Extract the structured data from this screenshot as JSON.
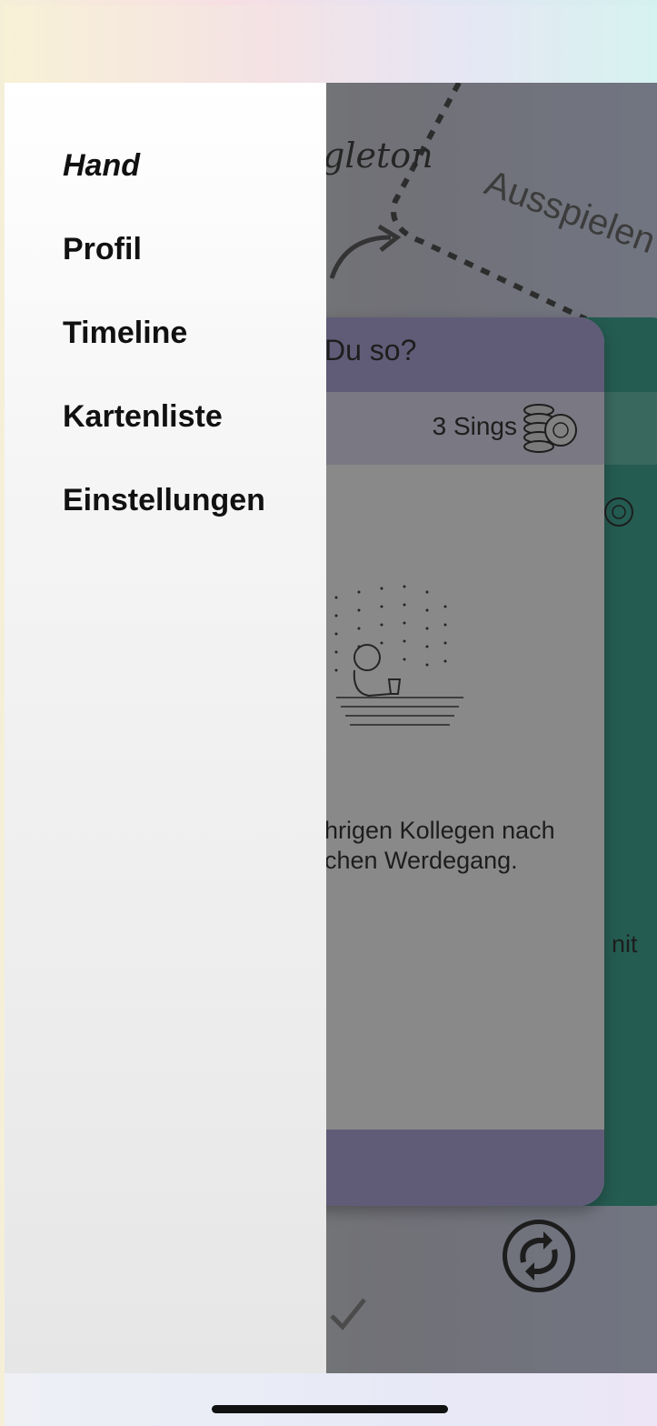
{
  "tutorial": {
    "singleton_label": "gleton",
    "ausspielen_label": "Ausspielen"
  },
  "card": {
    "title": "Du so?",
    "cost": "3 Sings",
    "text_line_1": "hrigen Kollegen nach",
    "text_line_2": "chen Werdegang.",
    "accent_color": "#a49bd8"
  },
  "back_card": {
    "text_fragment": "nit",
    "accent_color": "#1f9b84"
  },
  "drawer": {
    "items": [
      {
        "label": "Hand",
        "active": true
      },
      {
        "label": "Profil",
        "active": false
      },
      {
        "label": "Timeline",
        "active": false
      },
      {
        "label": "Kartenliste",
        "active": false
      },
      {
        "label": "Einstellungen",
        "active": false
      }
    ]
  },
  "icons": [
    "coins-icon",
    "refresh-icon",
    "check-icon"
  ]
}
